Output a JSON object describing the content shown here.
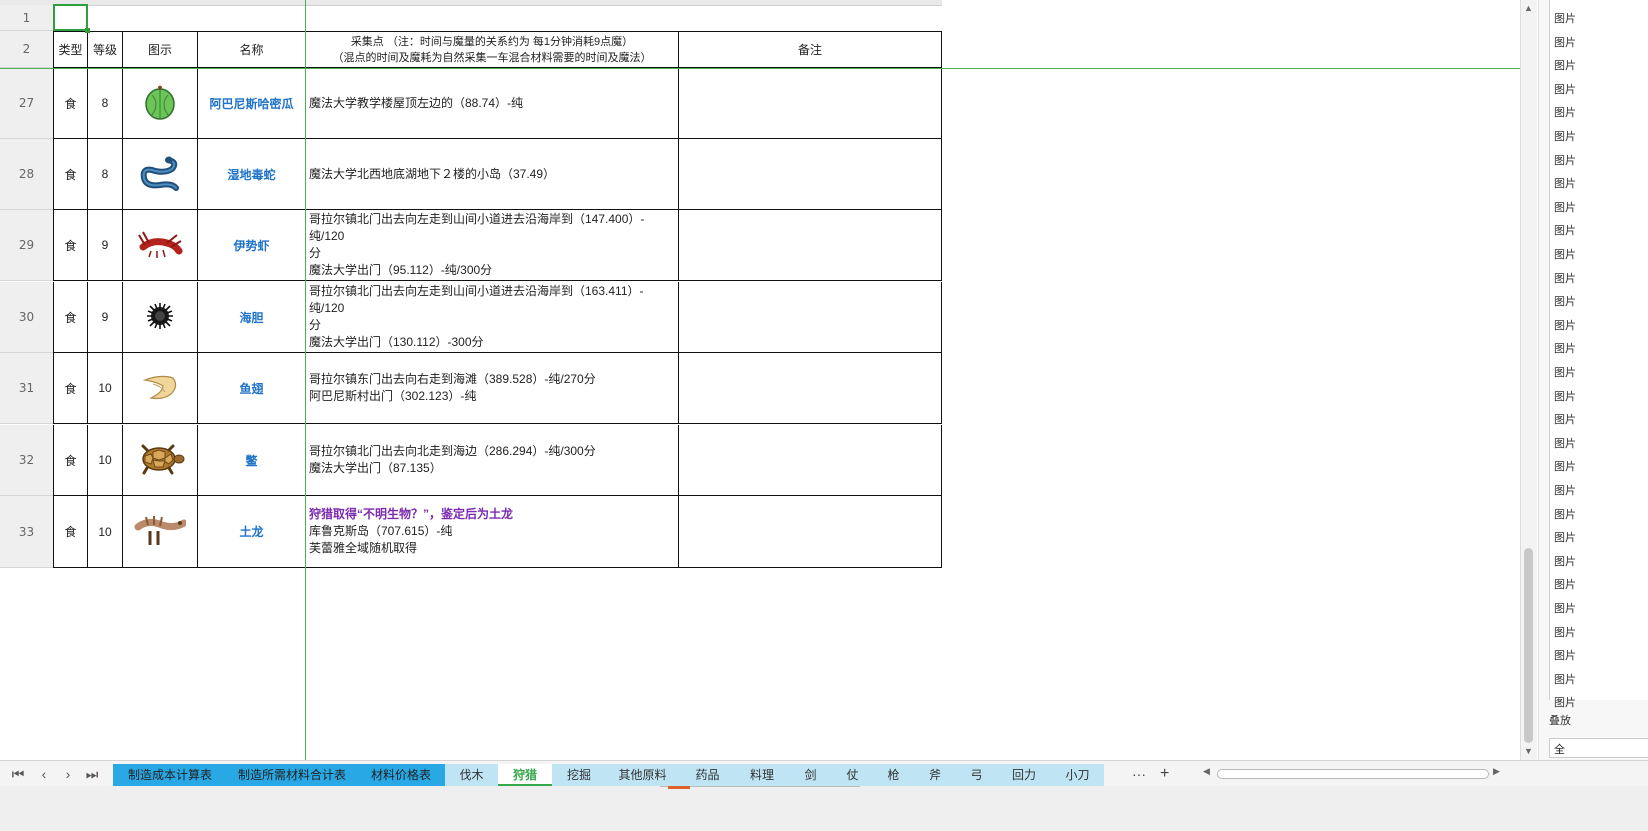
{
  "header": {
    "type": "类型",
    "level": "等级",
    "icon": "图示",
    "name": "名称",
    "loc_line1": "采集点 （注：时间与魔量的关系约为 每1分钟消耗9点魔）",
    "loc_line2": "（混点的时间及魔耗为自然采集一车混合材料需要的时间及魔法）",
    "remark": "备注"
  },
  "row_numbers": {
    "r1": "1",
    "r2": "2"
  },
  "rows": [
    {
      "num": "27",
      "type": "食",
      "level": "8",
      "name": "阿巴尼斯哈密瓜",
      "icon": "melon-icon",
      "lines": [
        "魔法大学教学楼屋顶左边的（88.74）-纯"
      ]
    },
    {
      "num": "28",
      "type": "食",
      "level": "8",
      "name": "湿地毒蛇",
      "icon": "snake-icon",
      "lines": [
        "魔法大学北西地底湖地下２楼的小岛（37.49）"
      ]
    },
    {
      "num": "29",
      "type": "食",
      "level": "9",
      "name": "伊势虾",
      "icon": "lobster-icon",
      "lines": [
        "哥拉尔镇北门出去向左走到山间小道进去沿海岸到（147.400）-纯/120",
        "分",
        "魔法大学出门（95.112）-纯/300分"
      ]
    },
    {
      "num": "30",
      "type": "食",
      "level": "9",
      "name": "海胆",
      "icon": "sea-urchin-icon",
      "lines": [
        "哥拉尔镇北门出去向左走到山间小道进去沿海岸到（163.411）-纯/120",
        "分",
        "魔法大学出门（130.112）-300分"
      ]
    },
    {
      "num": "31",
      "type": "食",
      "level": "10",
      "name": "鱼翅",
      "icon": "shark-fin-icon",
      "lines": [
        "哥拉尔镇东门出去向右走到海滩（389.528）-纯/270分",
        "阿巴尼斯村出门（302.123）-纯"
      ]
    },
    {
      "num": "32",
      "type": "食",
      "level": "10",
      "name": "鳖",
      "icon": "turtle-icon",
      "lines": [
        "哥拉尔镇北门出去向北走到海边（286.294）-纯/300分",
        "魔法大学出门（87.135）"
      ]
    },
    {
      "num": "33",
      "type": "食",
      "level": "10",
      "name": "土龙",
      "icon": "earth-dragon-icon",
      "highlight": "狩猎取得“不明生物？”，鉴定后为土龙",
      "lines": [
        "库鲁克斯岛（707.615）-纯",
        "芙蕾雅全域随机取得"
      ]
    }
  ],
  "sheet_tabs": [
    {
      "label": "制造成本计算表",
      "style": "blue"
    },
    {
      "label": "制造所需材料合计表",
      "style": "blue"
    },
    {
      "label": "材料价格表",
      "style": "blue"
    },
    {
      "label": "伐木",
      "style": "light"
    },
    {
      "label": "狩猎",
      "style": "active"
    },
    {
      "label": "挖掘",
      "style": "light"
    },
    {
      "label": "其他原料",
      "style": "light"
    },
    {
      "label": "药品",
      "style": "light"
    },
    {
      "label": "料理",
      "style": "light"
    },
    {
      "label": "剑",
      "style": "light"
    },
    {
      "label": "仗",
      "style": "light"
    },
    {
      "label": "枪",
      "style": "light"
    },
    {
      "label": "斧",
      "style": "light"
    },
    {
      "label": "弓",
      "style": "light"
    },
    {
      "label": "回力",
      "style": "light"
    },
    {
      "label": "小刀",
      "style": "light"
    }
  ],
  "tab_nav": {
    "first": "⏮",
    "prev": "‹",
    "next": "›",
    "last": "⏭",
    "more": "···",
    "add": "+"
  },
  "side_panel": {
    "item_label": "图片",
    "label2": "叠放",
    "box": "全"
  },
  "colors": {
    "name_blue": "#1f73c8",
    "highlight_purple": "#7b2bb0",
    "active_tab_green": "#35a84a",
    "tab_blue": "#29a8e6"
  }
}
